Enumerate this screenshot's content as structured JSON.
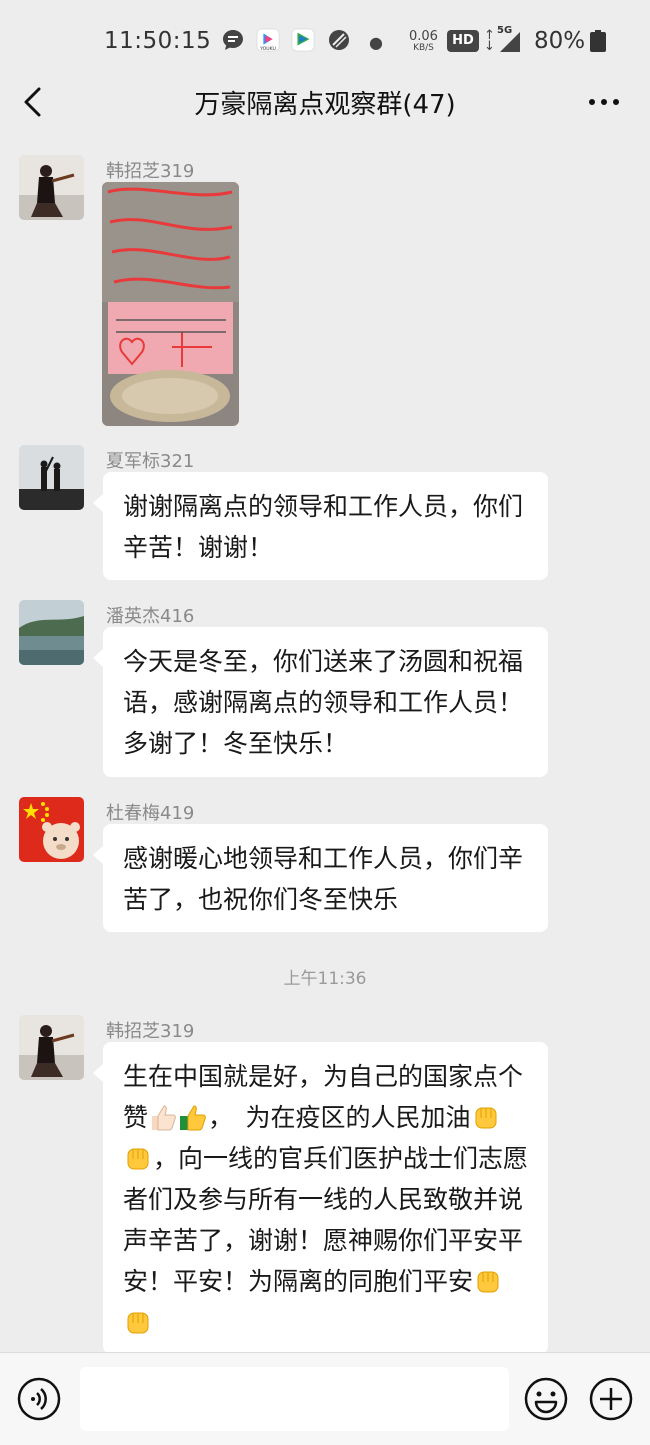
{
  "status_bar": {
    "time": "11:50:15",
    "speed_value": "0.06",
    "speed_unit": "KB/S",
    "hd": "HD",
    "network": "5G",
    "battery": "80%",
    "icons": [
      "message-icon",
      "youku-app-icon",
      "video-app-icon",
      "no-disturb-icon",
      "dot-icon",
      "signal-icon",
      "battery-icon"
    ]
  },
  "header": {
    "title": "万豪隔离点观察群(47)"
  },
  "messages": [
    {
      "sender": "韩招芝319",
      "type": "image"
    },
    {
      "sender": "夏军标321",
      "type": "text",
      "text": "谢谢隔离点的领导和工作人员，你们辛苦！谢谢！"
    },
    {
      "sender": "潘英杰416",
      "type": "text",
      "text": "今天是冬至，你们送来了汤圆和祝福语，感谢隔离点的领导和工作人员！多谢了！冬至快乐！"
    },
    {
      "sender": "杜春梅419",
      "type": "text",
      "text": "感谢暖心地领导和工作人员，你们辛苦了，也祝你们冬至快乐"
    },
    {
      "sender": "韩招芝319",
      "type": "text",
      "parts": [
        "生在中国就是好，为自己的国家点个赞",
        "，　为在疫区的人民加油",
        "，向一线的官兵们医护战士们志愿者们及参与所有一线的人民致敬并说声辛苦了，谢谢！愿神赐你们平安平安！平安！为隔离的同胞们平安"
      ]
    }
  ],
  "timestamp": "上午11:36",
  "colors": {
    "background": "#ededed",
    "bubble": "#ffffff",
    "sender_name": "#8a8a8a"
  }
}
